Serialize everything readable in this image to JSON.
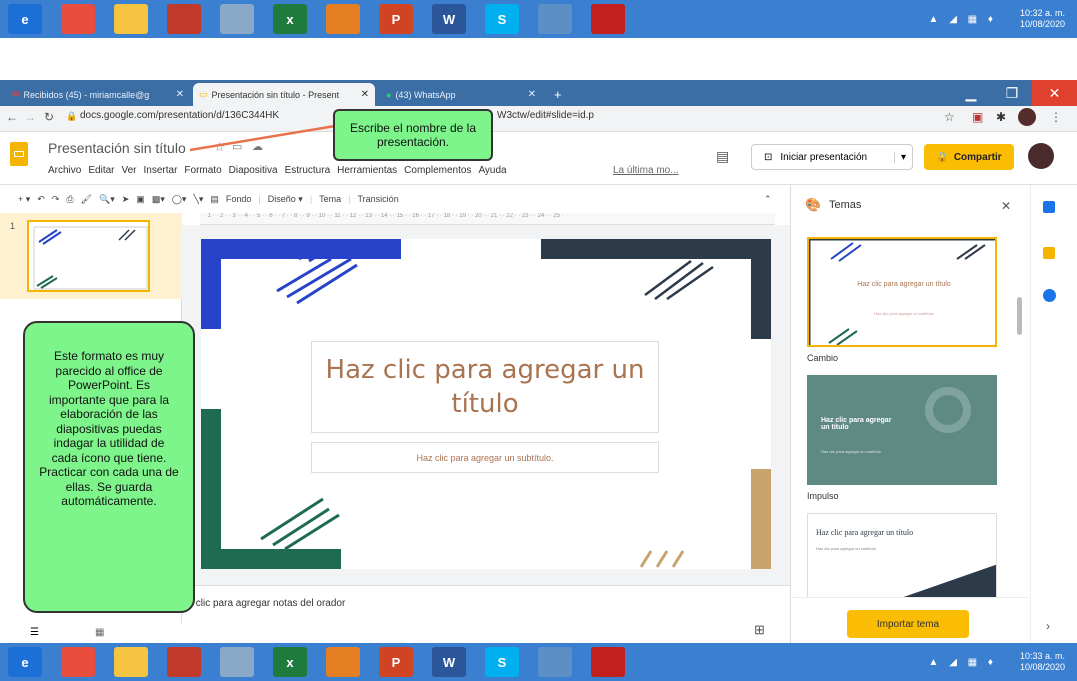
{
  "taskbar_top": {
    "apps": [
      {
        "icon": "ie-icon",
        "label": "e",
        "color": "#1c6fd6"
      },
      {
        "icon": "chrome-icon",
        "label": "",
        "color": "#e74c3c"
      },
      {
        "icon": "folder-icon",
        "label": "",
        "color": "#f5c542"
      },
      {
        "icon": "paint-icon",
        "label": "",
        "color": "#c0392b"
      },
      {
        "icon": "notepad-icon",
        "label": "",
        "color": "#8aa9c9"
      },
      {
        "icon": "excel-icon",
        "label": "x",
        "color": "#1f7a3d"
      },
      {
        "icon": "firefox-icon",
        "label": "",
        "color": "#e67e22"
      },
      {
        "icon": "powerpoint-icon",
        "label": "P",
        "color": "#d04423"
      },
      {
        "icon": "word-icon",
        "label": "W",
        "color": "#2b579a"
      },
      {
        "icon": "skype-icon",
        "label": "S",
        "color": "#00aff0"
      },
      {
        "icon": "window-icon",
        "label": "",
        "color": "#5d8fc7"
      },
      {
        "icon": "acrobat-icon",
        "label": "",
        "color": "#c21f1f"
      }
    ],
    "time": "10:32 a. m.",
    "date": "10/08/2020"
  },
  "taskbar_bottom": {
    "time": "10:33 a. m.",
    "date": "10/08/2020"
  },
  "browser": {
    "tabs": [
      {
        "label": "Recibidos (45) - miriamcalle@g",
        "active": false
      },
      {
        "label": "Presentación sin título - Present",
        "active": true
      },
      {
        "label": "(43) WhatsApp",
        "active": false
      }
    ],
    "new_tab": "+",
    "url": "docs.google.com/presentation/d/136C344HK",
    "url_tail": "W3ctw/edit#slide=id.p"
  },
  "docs": {
    "title": "Presentación sin título",
    "menu": [
      "Archivo",
      "Editar",
      "Ver",
      "Insertar",
      "Formato",
      "Diapositiva",
      "Estructura",
      "Herramientas",
      "Complementos",
      "Ayuda"
    ],
    "last_edit": "La última mo...",
    "present_label": "Iniciar presentación",
    "share_label": "Compartir"
  },
  "toolbar": {
    "items": [
      "Fondo",
      "Diseño",
      "Tema",
      "Transición"
    ]
  },
  "slide": {
    "title": "Haz clic para agregar un título",
    "subtitle": "Haz clic para agregar un subtítulo.",
    "notes": "z clic para agregar notas del orador",
    "slide_number": "1"
  },
  "themes_panel": {
    "title": "Temas",
    "themes": [
      {
        "name": "Cambio",
        "preview_title": "Haz clic para agregar un título",
        "preview_sub": "Haz clic para agregar un subtítulo"
      },
      {
        "name": "Impulso",
        "preview_title": "Haz clic para agregar un título",
        "preview_sub": "Haz clic para agregar un subtítulo"
      },
      {
        "name": "",
        "preview_title": "Haz clic para agregar un título",
        "preview_sub": "Haz clic para agregar un subtítulo"
      }
    ],
    "import_label": "Importar tema"
  },
  "callouts": {
    "top": "Escribe el nombre de la presentación.",
    "left": "Este formato es muy parecido al office de PowerPoint. Es importante que para la elaboración de las diapositivas puedas indagar la utilidad de cada ícono que tiene. Practicar con cada una de ellas. Se guarda automáticamente."
  },
  "colors": {
    "taskbar": "#3b7fd0",
    "tabbar": "#3a6ea5",
    "share": "#fbbc04",
    "callout": "#7df58b",
    "accent": "#a97451"
  }
}
